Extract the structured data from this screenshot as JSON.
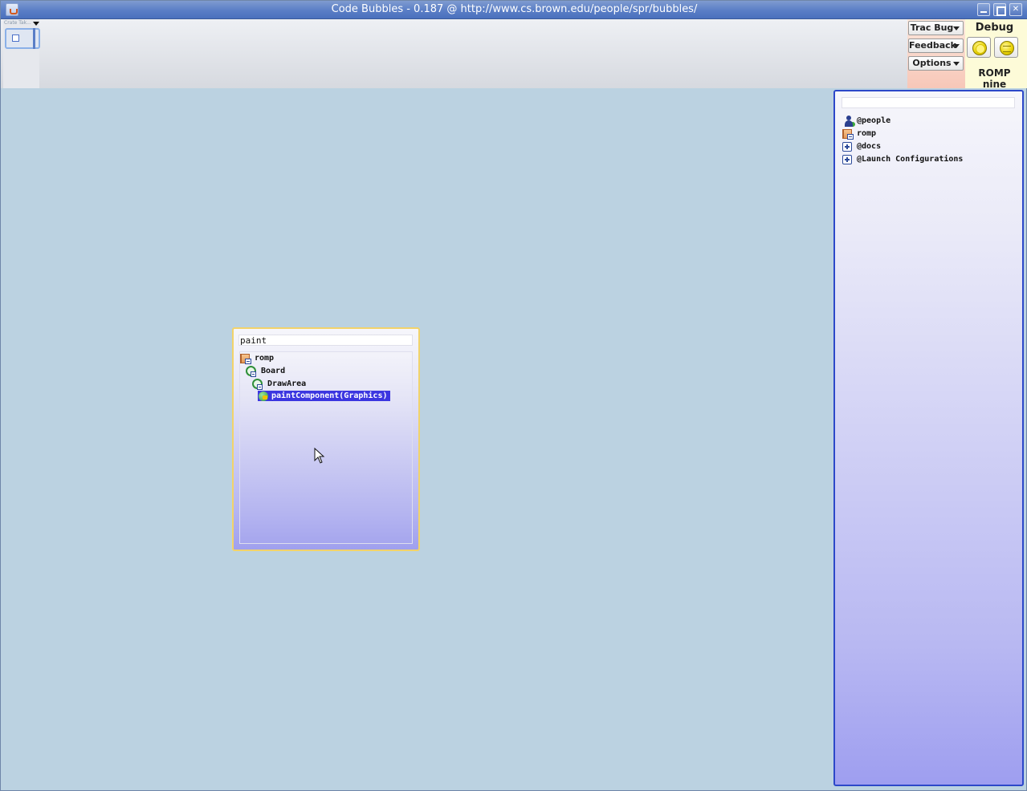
{
  "window": {
    "title": "Code Bubbles - 0.187 @ http://www.cs.brown.edu/people/spr/bubbles/"
  },
  "overview": {
    "label": "Crate Tak..."
  },
  "toolbar": {
    "trac_bug_label": "Trac Bug",
    "feedback_label": "Feedback",
    "options_label": "Options"
  },
  "debug": {
    "label": "Debug",
    "workspace_name": "ROMP nine"
  },
  "explorer": {
    "search_value": "",
    "items": [
      {
        "label": "@people",
        "icon": "people-icon"
      },
      {
        "label": "romp",
        "icon": "package-icon"
      },
      {
        "label": "@docs",
        "icon": "expand-icon"
      },
      {
        "label": "@Launch Configurations",
        "icon": "expand-icon"
      }
    ]
  },
  "search_bubble": {
    "query": "paint",
    "results": [
      {
        "label": "romp",
        "icon": "package-icon"
      },
      {
        "label": "Board",
        "icon": "class-icon"
      },
      {
        "label": "DrawArea",
        "icon": "class-icon"
      },
      {
        "label": "paintComponent(Graphics)",
        "icon": "method-icon",
        "selected": true
      }
    ]
  },
  "colors": {
    "workspace_bg": "#bbd2e1",
    "titlebar": "#5a7ec6",
    "explorer_border": "#2c48c9",
    "bubble_border": "#f2d36a",
    "selection": "#3b36e0"
  }
}
